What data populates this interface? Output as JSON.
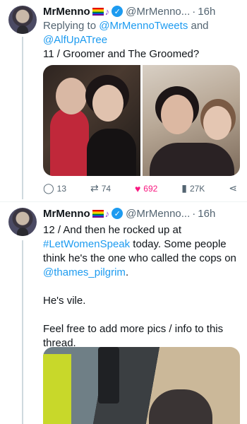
{
  "tweet1": {
    "name": "MrMenno",
    "handle": "@MrMenno...",
    "time": "16h",
    "replying_prefix": "Replying to",
    "reply_to_1": "@MrMennoTweets",
    "reply_and": "and",
    "reply_to_2": "@AlfUpATree",
    "text": "11 / Groomer and The Groomed?",
    "stats": {
      "replies": "13",
      "retweets": "74",
      "likes": "692",
      "views": "27K"
    }
  },
  "tweet2": {
    "name": "MrMenno",
    "handle": "@MrMenno...",
    "time": "16h",
    "text_part1": "12 / And then he rocked up at ",
    "hashtag": "#LetWomenSpeak",
    "text_part2": " today. Some people think he's the one who called the cops on ",
    "mention": "@thames_pilgrim",
    "text_part3": ".",
    "para2": "He's vile.",
    "para3": "Feel free to add more pics / info to this thread."
  },
  "icons": {
    "verified": "verified-badge-icon",
    "reply": "reply-icon",
    "retweet": "retweet-icon",
    "like": "heart-icon",
    "views": "views-icon",
    "share": "share-icon",
    "more": "more-icon"
  },
  "colors": {
    "link": "#1d9bf0",
    "like": "#f91880",
    "muted": "#536471"
  }
}
